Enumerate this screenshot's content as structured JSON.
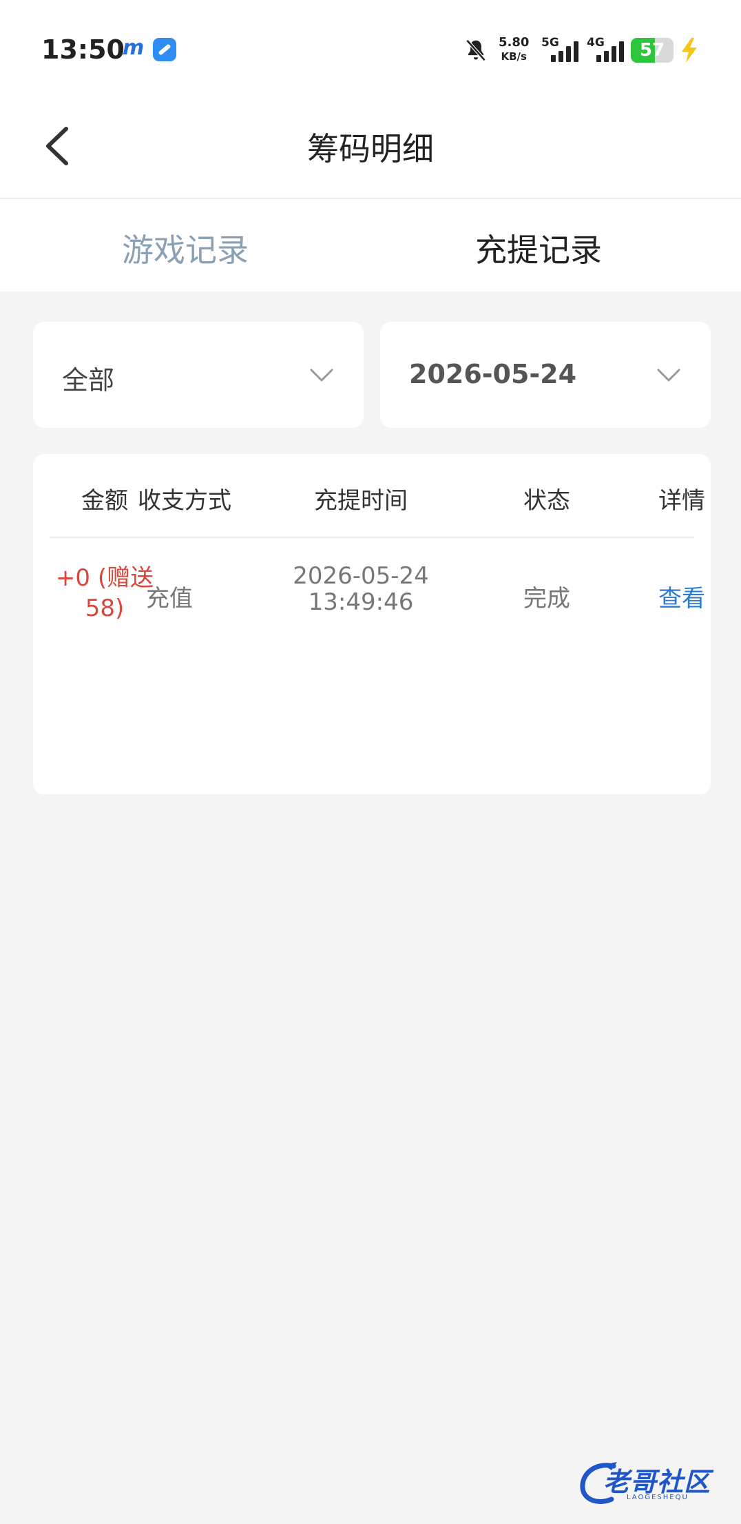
{
  "status_bar": {
    "time": "13:50",
    "app_icon_m": "m",
    "net_speed": "5.80",
    "net_speed_unit": "KB/s",
    "net1_label": "5G",
    "net2_label": "4G",
    "battery_level": "57",
    "battery_fraction": 0.57,
    "battery_color": "#2dc53c"
  },
  "nav": {
    "title": "筹码明细"
  },
  "tabs": [
    {
      "label": "游戏记录",
      "active": false
    },
    {
      "label": "充提记录",
      "active": true
    }
  ],
  "filters": {
    "type_value": "全部",
    "date_value": "2026-05-24"
  },
  "table": {
    "headers": [
      "金额",
      "收支方式",
      "充提时间",
      "状态",
      "详情"
    ],
    "rows": [
      {
        "amount_line1": "+0 (赠送",
        "amount_line2": "58)",
        "method": "充值",
        "date": "2026-05-24",
        "time": "13:49:46",
        "status": "完成",
        "detail": "查看"
      }
    ]
  },
  "watermark": {
    "text": "老哥社区",
    "sub": "LAOGESHEQU"
  },
  "colors": {
    "amount": "#d9473a",
    "link": "#2a7bd6",
    "inactive_tab": "#8aa0b4"
  }
}
